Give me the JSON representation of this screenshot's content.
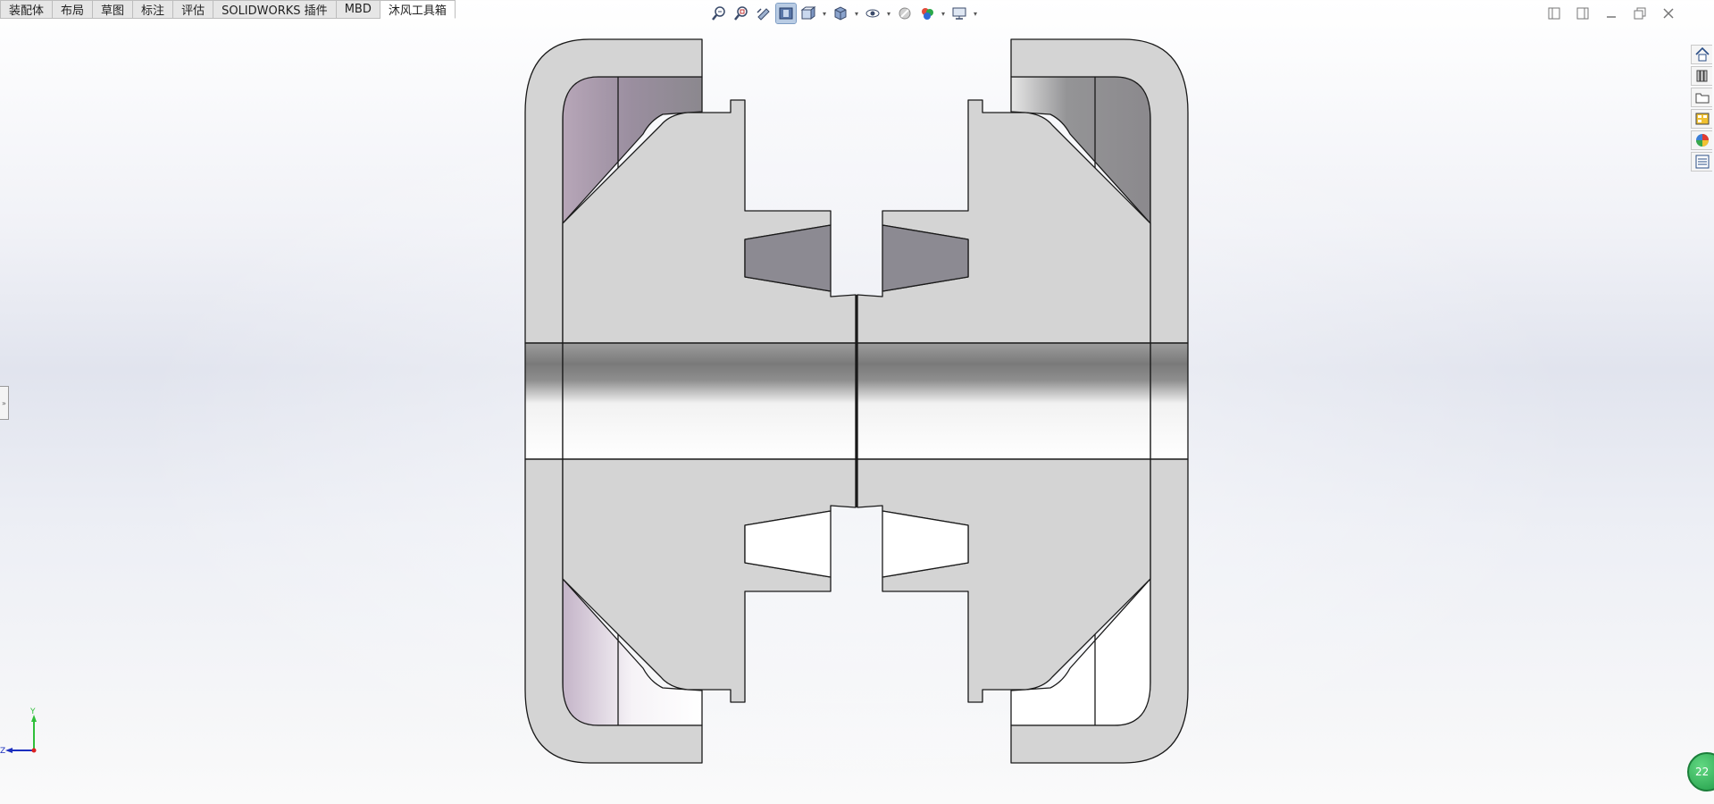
{
  "tabs": [
    {
      "label": "装配体"
    },
    {
      "label": "布局"
    },
    {
      "label": "草图"
    },
    {
      "label": "标注"
    },
    {
      "label": "评估"
    },
    {
      "label": "SOLIDWORKS 插件"
    },
    {
      "label": "MBD"
    },
    {
      "label": "沐风工具箱",
      "active": true
    }
  ],
  "hud_icons": [
    "zoom-to-fit-icon",
    "zoom-to-area-icon",
    "previous-view-icon",
    "section-view-icon",
    "view-orientation-icon",
    "display-style-icon",
    "hide-show-items-icon",
    "edit-appearance-icon",
    "apply-scene-icon",
    "view-settings-icon"
  ],
  "taskpane_icons": [
    "home-icon",
    "design-library-icon",
    "file-explorer-icon",
    "view-palette-icon",
    "appearances-icon",
    "custom-properties-icon"
  ],
  "triad": {
    "y": "Y",
    "z": "Z"
  },
  "badge_text": "22",
  "colors": {
    "part_face": "#d4d4d4",
    "part_edge": "#1a1a1a",
    "cavity_dark": "#8c8a92",
    "active_tab_bg": "#ffffff",
    "tab_bg": "#e6e6e6",
    "hud_active": "#b9cce4",
    "triad_y": "#2fbf3a",
    "triad_z": "#1b2fbf"
  }
}
